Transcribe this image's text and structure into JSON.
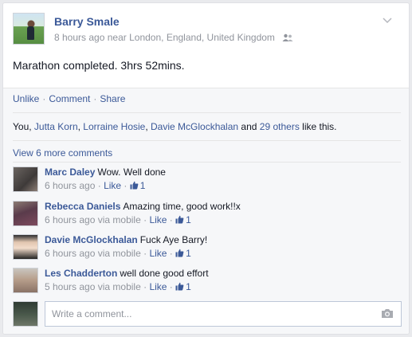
{
  "post": {
    "author": "Barry Smale",
    "time": "8 hours ago",
    "near": "near",
    "location": {
      "city": "London",
      "region": "England",
      "country": "United Kingdom"
    },
    "text": "Marathon completed. 3hrs 52mins.",
    "audience_icon": "friends-icon",
    "menu_icon": "chevron-down-icon"
  },
  "actions": {
    "unlike": "Unlike",
    "comment": "Comment",
    "share": "Share",
    "separator": "·"
  },
  "likes": {
    "you": "You",
    "names": [
      "Jutta Korn",
      "Lorraine Hosie",
      "Davie McGlockhalan"
    ],
    "and": "and",
    "others": "29 others",
    "suffix": "like this."
  },
  "view_more": "View 6 more comments",
  "comments": [
    {
      "author": "Marc Daley",
      "text": "Wow. Well done",
      "time": "6 hours ago",
      "via": "",
      "like_label": "Like",
      "like_count": "1"
    },
    {
      "author": "Rebecca Daniels",
      "text": "Amazing time, good work!!x",
      "time": "6 hours ago",
      "via": "via mobile",
      "like_label": "Like",
      "like_count": "1"
    },
    {
      "author": "Davie McGlockhalan",
      "text": "Fuck Aye Barry!",
      "time": "6 hours ago",
      "via": "via mobile",
      "like_label": "Like",
      "like_count": "1"
    },
    {
      "author": "Les Chadderton",
      "text": "well done good effort",
      "time": "5 hours ago",
      "via": "via mobile",
      "like_label": "Like",
      "like_count": "1"
    }
  ],
  "composer": {
    "placeholder": "Write a comment...",
    "icon": "camera-icon"
  },
  "colors": {
    "link": "#3b5998",
    "meta": "#90949c",
    "text": "#141823",
    "footer_bg": "#f6f7f9"
  }
}
